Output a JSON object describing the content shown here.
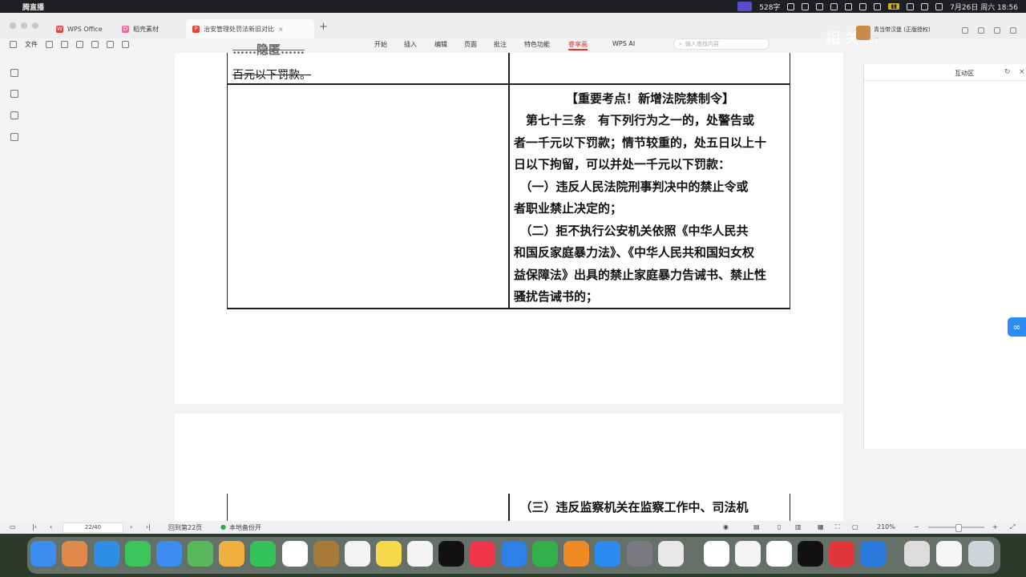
{
  "menubar": {
    "app_name": "腾直播",
    "word_count": "528字",
    "date_time": "7月26日 周六 18:56"
  },
  "tabs": [
    {
      "label": "WPS Office"
    },
    {
      "label": "稻壳素材"
    },
    {
      "label": "治安管理处罚法新旧对比"
    }
  ],
  "toolbar": {
    "file_label": "文件",
    "menus": [
      "开始",
      "插入",
      "编辑",
      "页面",
      "批注",
      "特色功能",
      "睿享画",
      "WPS AI"
    ],
    "search_placeholder": "输入查找内容"
  },
  "notification": {
    "title": "青当带汉堡 (正版授权)",
    "subtitle": "…"
  },
  "watermark": "相关…",
  "document": {
    "row1_left_lines": [
      "……隐匿……",
      "百元以下罚款。"
    ],
    "row2_right_lines": [
      "【重要考点！新增法院禁制令】",
      "　第七十三条　有下列行为之一的，处警告或",
      "者一千元以下罚款；情节较重的，处五日以上十",
      "日以下拘留，可以并处一千元以下罚款：",
      "　（一）违反人民法院刑事判决中的禁止令或",
      "者职业禁止决定的；",
      "　（二）拒不执行公安机关依照《中华人民共",
      "和国反家庭暴力法》、《中华人民共和国妇女权",
      "益保障法》出具的禁止家庭暴力告诫书、禁止性",
      "骚扰告诫书的；"
    ],
    "page2_right_line": "　（三）违反监察机关在监察工作中、司法机"
  },
  "right_panel": {
    "title": "互动区"
  },
  "status": {
    "page_input": "22/40",
    "goto_page": "回到第22页",
    "backup": "本地备份开",
    "zoom": "210%"
  }
}
